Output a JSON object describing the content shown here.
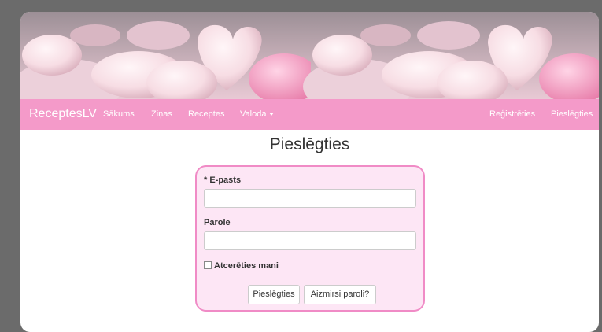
{
  "navbar": {
    "brand": "ReceptesLV",
    "items": [
      "Sākums",
      "Ziņas",
      "Receptes",
      "Valoda"
    ],
    "right_items": [
      "Reģistrēties",
      "Pieslēgties"
    ]
  },
  "banner": {
    "image": "pink heart marshmallows"
  },
  "page": {
    "title": "Pieslēgties"
  },
  "form": {
    "email_label": "* E-pasts",
    "email_value": "",
    "password_label": "Parole",
    "password_value": "",
    "remember_label": "Atcerēties mani",
    "login_button": "Pieslēgties",
    "forgot_button": "Aizmirsi paroli?"
  },
  "colors": {
    "navbar": "#f49ac9",
    "box_border": "#f08bc6",
    "box_background": "#fde6f5"
  }
}
